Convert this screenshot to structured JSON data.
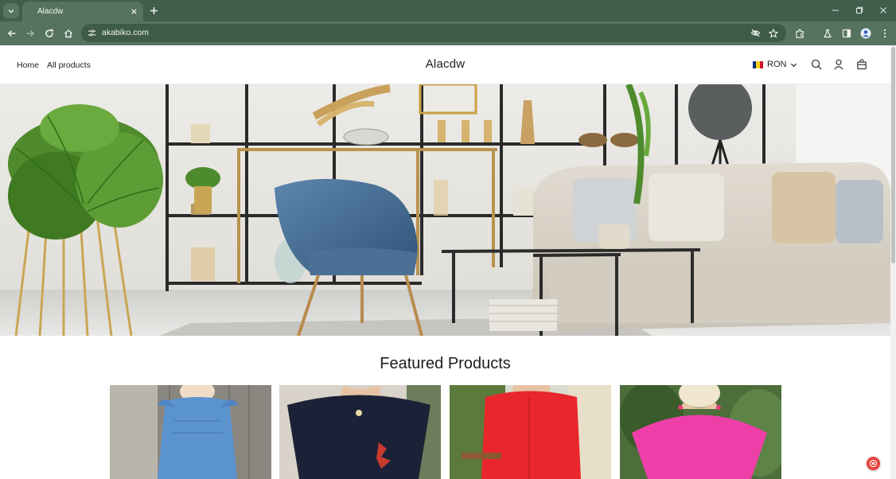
{
  "browser": {
    "tab_title": "Alacdw",
    "url": "akabiko.com",
    "colors": {
      "frame": "#3f5e4b",
      "toolbar": "#56735f",
      "omnibox": "#3e5b47"
    },
    "icons": [
      "tab-list-icon",
      "close-icon",
      "new-tab-icon",
      "minimize-icon",
      "restore-icon",
      "window-close-icon",
      "back-icon",
      "forward-icon",
      "reload-icon",
      "home-icon",
      "site-info-icon",
      "tracking-eye-off-icon",
      "bookmark-star-icon",
      "extensions-icon",
      "labs-flask-icon",
      "side-panel-icon",
      "profile-avatar-icon",
      "kebab-menu-icon"
    ]
  },
  "header": {
    "nav": [
      {
        "label": "Home"
      },
      {
        "label": "All products"
      }
    ],
    "logo": "Alacdw",
    "currency": "RON",
    "icons": [
      "romania-flag-icon",
      "chevron-down-icon",
      "search-icon",
      "account-icon",
      "cart-bag-icon"
    ]
  },
  "hero": {
    "description_icon": "living-room-banner-image"
  },
  "featured": {
    "title": "Featured Products",
    "products": [
      {
        "image": "blue-ruffle-top-photo",
        "color": "#5b93cf"
      },
      {
        "image": "navy-butterfly-top-photo",
        "color": "#1b2136"
      },
      {
        "image": "red-tunic-dress-photo",
        "color": "#e8262c"
      },
      {
        "image": "pink-batwing-top-photo",
        "color": "#ee3fa8"
      }
    ]
  },
  "widgets": {
    "chat_icon": "chat-support-icon",
    "chat_color": "#e8433e"
  }
}
